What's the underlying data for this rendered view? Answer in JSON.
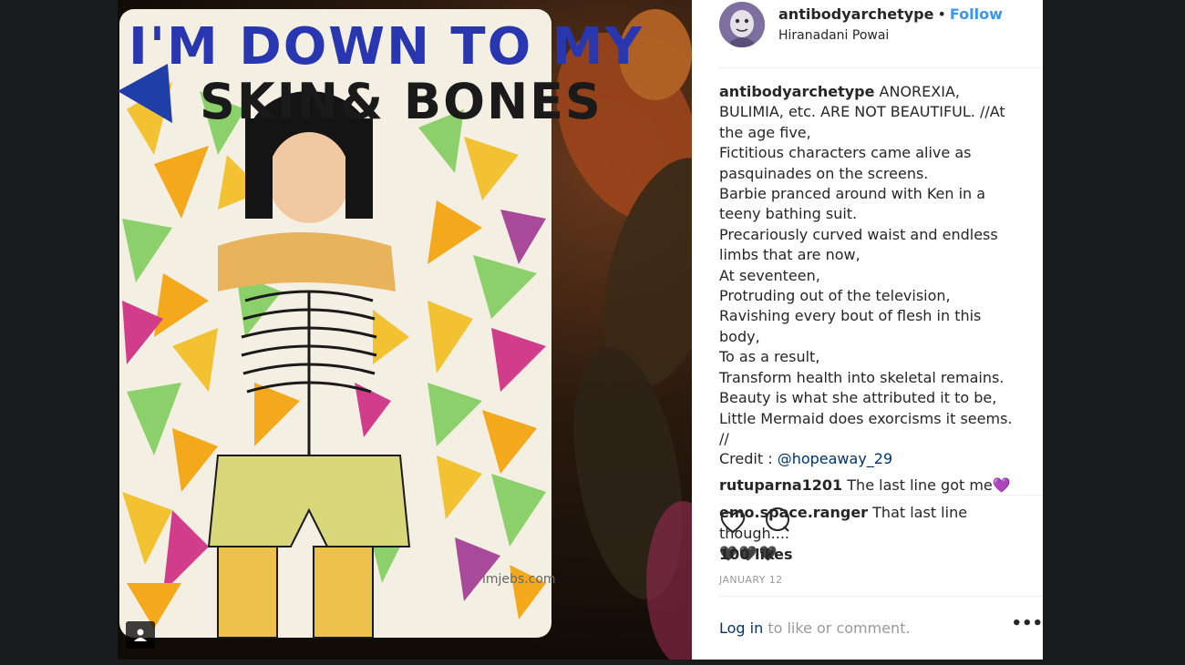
{
  "post": {
    "username": "antibodyarchetype",
    "separator": "•",
    "follow_label": "Follow",
    "location": "Hiranadani Powai",
    "image_title": "I'M DOWN TO MY SKIN & BONES",
    "watermark": "imjebs.com"
  },
  "caption": {
    "username": "antibodyarchetype",
    "text": "ANOREXIA, BULIMIA, etc. ARE NOT BEAUTIFUL. //At the age five,\nFictitious characters came alive as pasquinades on the screens.\nBarbie pranced around with Ken in a teeny bathing suit.\nPrecariously curved waist and endless limbs that are now,\nAt seventeen,\nProtruding out of the television,\nRavishing every bout of flesh in this body,\nTo as a result,\nTransform health into skeletal remains.\nBeauty is what she attributed it to be,\nLittle Mermaid does exorcisms it seems. //\nCredit : ",
    "mention": "@hopeaway_29"
  },
  "comments": [
    {
      "username": "rutuparna1201",
      "text": "The last line got me",
      "emoji": "💜"
    },
    {
      "username": "emo.space.ranger",
      "text": "That last line though....",
      "emoji": "🖤🖤🖤"
    }
  ],
  "actions": {
    "like_icon": "heart-icon",
    "comment_icon": "speech-bubble-icon"
  },
  "likes_label": "100 likes",
  "date_label": "JANUARY 12",
  "login": {
    "link_label": "Log in",
    "rest_label": " to like or comment."
  },
  "more_label": "•••",
  "colors": {
    "follow": "#3897f0",
    "link": "#003569",
    "muted": "#999999",
    "text": "#262626",
    "page_bg": "#1b1c1e"
  }
}
